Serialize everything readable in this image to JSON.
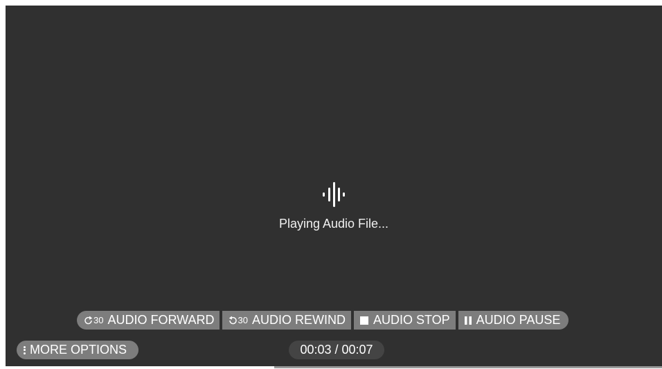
{
  "status": {
    "icon": "audio-wave-icon",
    "text": "Playing Audio File..."
  },
  "controls": [
    {
      "icon": "forward-30-icon",
      "icon_text": "30",
      "label": "AUDIO FORWARD"
    },
    {
      "icon": "rewind-30-icon",
      "icon_text": "30",
      "label": "AUDIO REWIND"
    },
    {
      "icon": "stop-icon",
      "label": "AUDIO STOP"
    },
    {
      "icon": "pause-icon",
      "label": "AUDIO PAUSE"
    }
  ],
  "more_options": {
    "icon": "more-vert-icon",
    "label": "MORE OPTIONS"
  },
  "time": {
    "display": "00:03 / 00:07",
    "current": "00:03",
    "total": "00:07"
  },
  "colors": {
    "background": "#303030",
    "button": "#7d7d7d",
    "time_pill": "#444444",
    "text": "#ffffff"
  }
}
